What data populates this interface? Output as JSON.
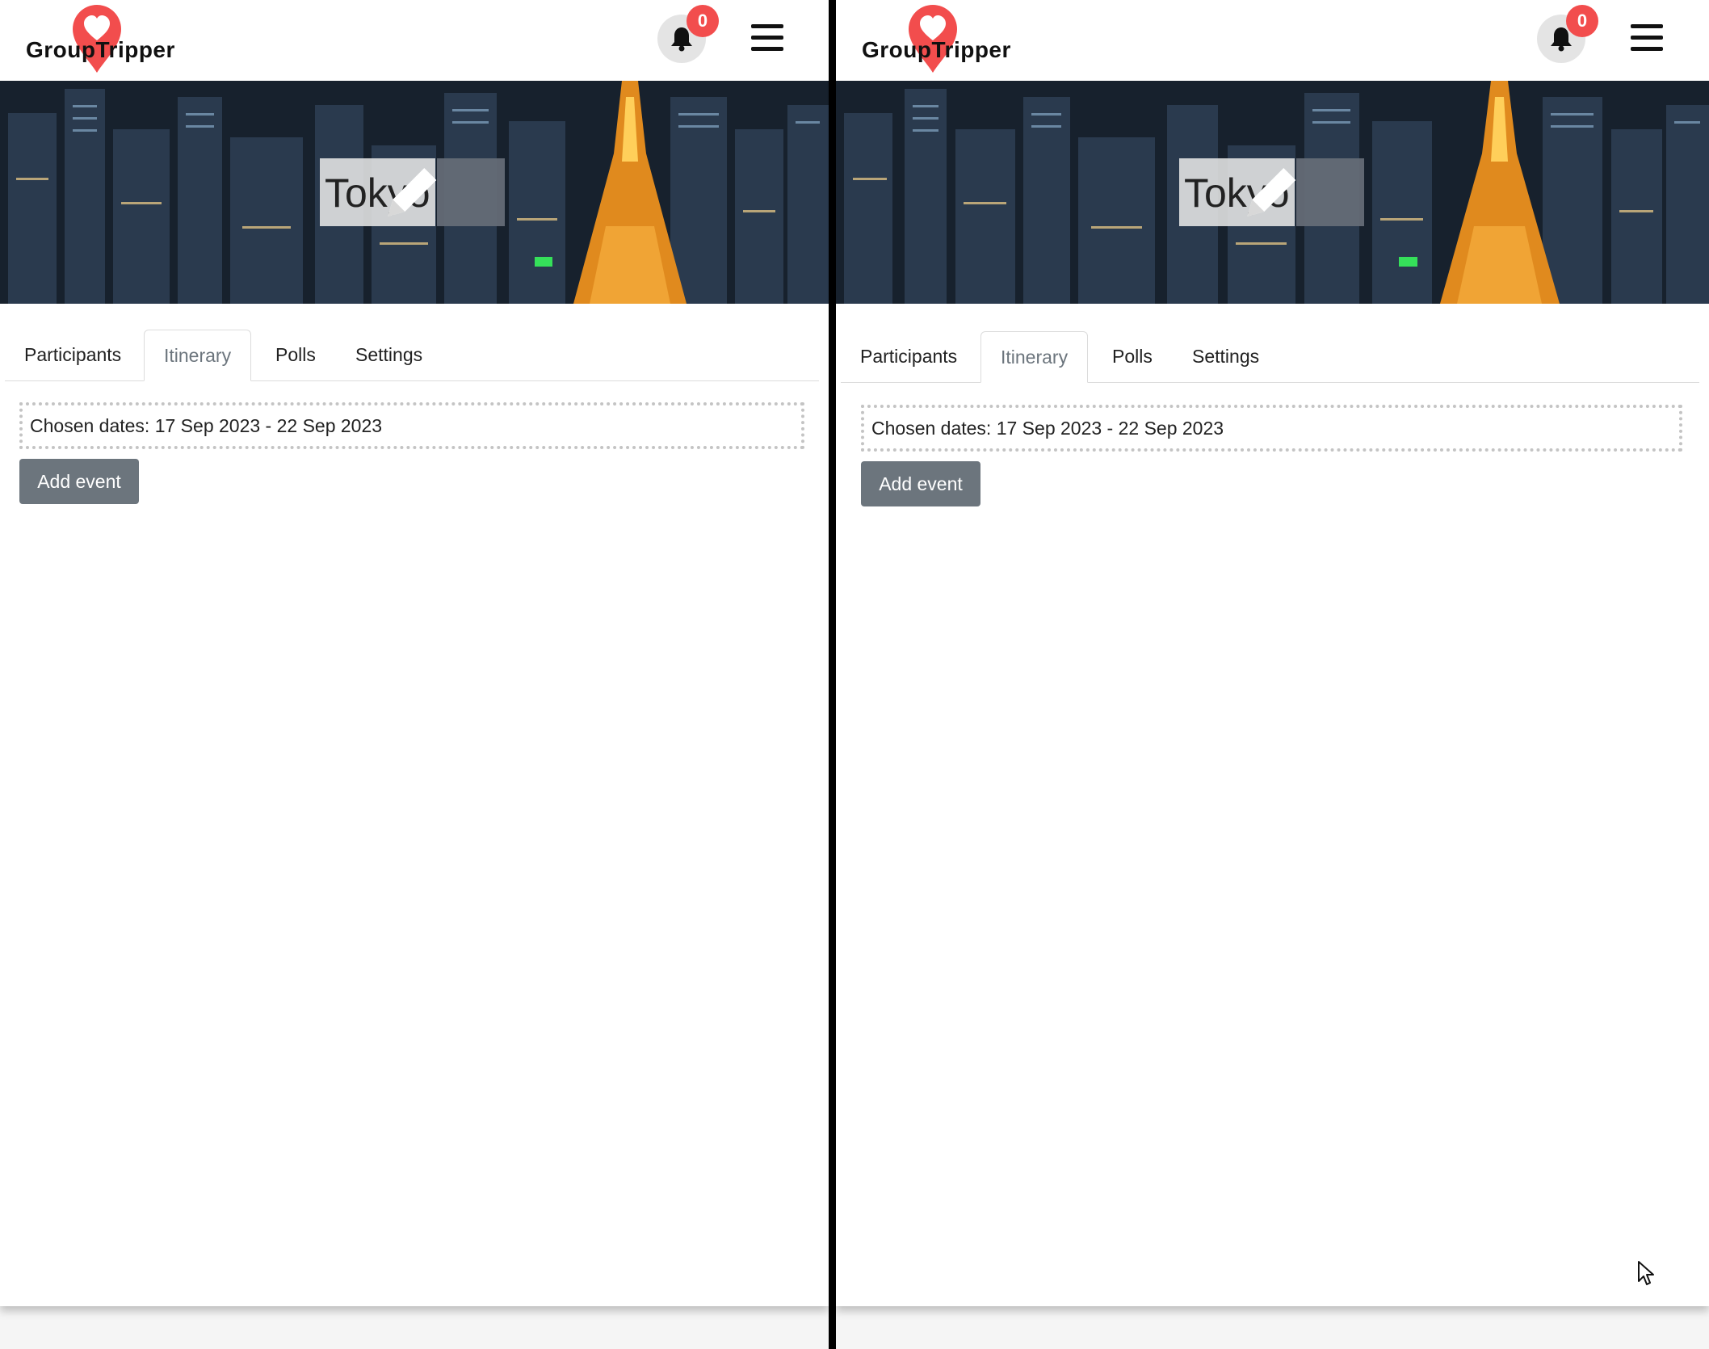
{
  "app": {
    "brand": "GroupTripper",
    "notification_count": "0"
  },
  "trip": {
    "title": "Tokyo"
  },
  "tabs": [
    {
      "label": "Participants"
    },
    {
      "label": "Itinerary"
    },
    {
      "label": "Polls"
    },
    {
      "label": "Settings"
    }
  ],
  "active_tab": "Itinerary",
  "itinerary": {
    "chosen_dates": "Chosen dates: 17 Sep 2023 - 22 Sep 2023",
    "add_event_label": "Add event"
  },
  "icons": [
    "heart-pin-icon",
    "bell-icon",
    "hamburger-menu-icon",
    "pencil-icon",
    "cursor-icon"
  ],
  "colors": {
    "brand_red": "#f24d4d",
    "secondary_button": "#6c757d",
    "bell_bg": "#e4e4e4"
  }
}
